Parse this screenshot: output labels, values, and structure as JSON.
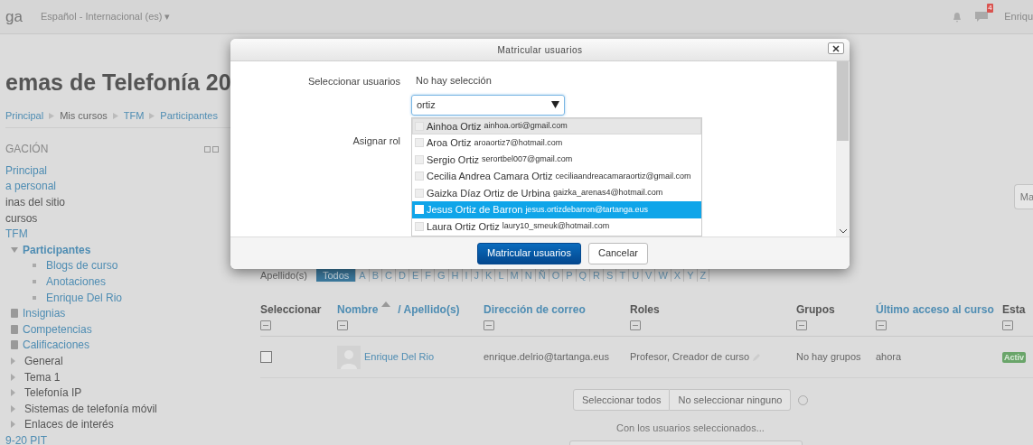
{
  "header": {
    "brand": "ga",
    "language": "Español - Internacional (es) ▾",
    "message_count": "4",
    "user": "Enriqu"
  },
  "page": {
    "title": "emas de Telefonía 20",
    "breadcrumb": [
      "Principal",
      "Mis cursos",
      "TFM",
      "Participantes"
    ]
  },
  "navigation": {
    "title": "GACIÓN",
    "items": [
      {
        "label": "Principal",
        "kind": "link"
      },
      {
        "label": "a personal",
        "kind": "link"
      },
      {
        "label": "inas del sitio",
        "kind": "text"
      },
      {
        "label": "cursos",
        "kind": "text"
      },
      {
        "label": "TFM",
        "kind": "link",
        "children": [
          {
            "label": "Participantes",
            "kind": "section",
            "expanded": true,
            "children": [
              {
                "label": "Blogs de curso",
                "kind": "bullet"
              },
              {
                "label": "Anotaciones",
                "kind": "bullet"
              },
              {
                "label": "Enrique Del Rio",
                "kind": "bullet"
              }
            ]
          },
          {
            "label": "Insignias",
            "kind": "tool"
          },
          {
            "label": "Competencias",
            "kind": "tool"
          },
          {
            "label": "Calificaciones",
            "kind": "tool"
          },
          {
            "label": "General",
            "kind": "topic"
          },
          {
            "label": "Tema 1",
            "kind": "topic"
          },
          {
            "label": "Telefonía IP",
            "kind": "topic"
          },
          {
            "label": "Sistemas de telefonía móvil",
            "kind": "topic"
          },
          {
            "label": "Enlaces de interés",
            "kind": "topic"
          }
        ]
      },
      {
        "label": "9-20 PIT",
        "kind": "link"
      }
    ]
  },
  "side_button": "Ma",
  "initials_filter": {
    "label": "Apellido(s)",
    "options": [
      {
        "label": "Todos",
        "selected": true
      },
      {
        "label": "A",
        "selected": false
      },
      {
        "label": "B",
        "selected": false
      },
      {
        "label": "C",
        "selected": false
      },
      {
        "label": "D",
        "selected": false
      },
      {
        "label": "E",
        "selected": false
      },
      {
        "label": "F",
        "selected": false
      },
      {
        "label": "G",
        "selected": false
      },
      {
        "label": "H",
        "selected": false
      },
      {
        "label": "I",
        "selected": false
      },
      {
        "label": "J",
        "selected": false
      },
      {
        "label": "K",
        "selected": false
      },
      {
        "label": "L",
        "selected": false
      },
      {
        "label": "M",
        "selected": false
      },
      {
        "label": "N",
        "selected": false
      },
      {
        "label": "Ñ",
        "selected": false
      },
      {
        "label": "O",
        "selected": false
      },
      {
        "label": "P",
        "selected": false
      },
      {
        "label": "Q",
        "selected": false
      },
      {
        "label": "R",
        "selected": false
      },
      {
        "label": "S",
        "selected": false
      },
      {
        "label": "T",
        "selected": false
      },
      {
        "label": "U",
        "selected": false
      },
      {
        "label": "V",
        "selected": false
      },
      {
        "label": "W",
        "selected": false
      },
      {
        "label": "X",
        "selected": false
      },
      {
        "label": "Y",
        "selected": false
      },
      {
        "label": "Z",
        "selected": false
      }
    ]
  },
  "table": {
    "columns": [
      {
        "label": "Seleccionar",
        "kind": "text"
      },
      {
        "label": "Nombre",
        "label_2": "/ Apellido(s)",
        "kind": "sorted"
      },
      {
        "label": "Dirección de correo",
        "kind": "link"
      },
      {
        "label": "Roles",
        "kind": "text"
      },
      {
        "label": "Grupos",
        "kind": "text"
      },
      {
        "label": "Último acceso al curso",
        "kind": "link"
      },
      {
        "label": "Esta",
        "kind": "text"
      }
    ],
    "rows": [
      {
        "checked": false,
        "name": "Enrique Del Rio",
        "email": "enrique.delrio@tartanga.eus",
        "roles": "Profesor, Creador de curso",
        "groups": "No hay grupos",
        "last_access": "ahora",
        "status": "Activ"
      }
    ]
  },
  "bulk": {
    "buttons": [
      "Seleccionar todos",
      "No seleccionar ninguno"
    ],
    "caption": "Con los usuarios seleccionados..."
  },
  "dialog": {
    "title": "Matricular usuarios",
    "select_label": "Seleccionar usuarios",
    "selection": "No hay selección",
    "search_value": "ortiz",
    "role_label": "Asignar rol",
    "suggestions": [
      {
        "name": "Ainhoa Ortiz",
        "email": "ainhoa.orti@gmail.com",
        "selected": false,
        "hovered": true
      },
      {
        "name": "Aroa Ortiz",
        "email": "aroaortiz7@hotmail.com",
        "selected": false,
        "hovered": false
      },
      {
        "name": "Sergio Ortiz",
        "email": "serortbel007@gmail.com",
        "selected": false,
        "hovered": false
      },
      {
        "name": "Cecilia Andrea Camara Ortiz",
        "email": "ceciliaandreacamaraortiz@gmail.com",
        "selected": false,
        "hovered": false
      },
      {
        "name": "Gaizka Díaz Ortiz de Urbina",
        "email": "gaizka_arenas4@hotmail.com",
        "selected": false,
        "hovered": false
      },
      {
        "name": "Jesus Ortiz de Barron",
        "email": "jesus.ortizdebarron@tartanga.eus",
        "selected": true,
        "hovered": false
      },
      {
        "name": "Laura Ortiz Ortiz",
        "email": "laury10_smeuk@hotmail.com",
        "selected": false,
        "hovered": false
      }
    ],
    "buttons": [
      {
        "label": "Matricular usuarios",
        "kind": "primary"
      },
      {
        "label": "Cancelar",
        "kind": "default"
      }
    ]
  }
}
